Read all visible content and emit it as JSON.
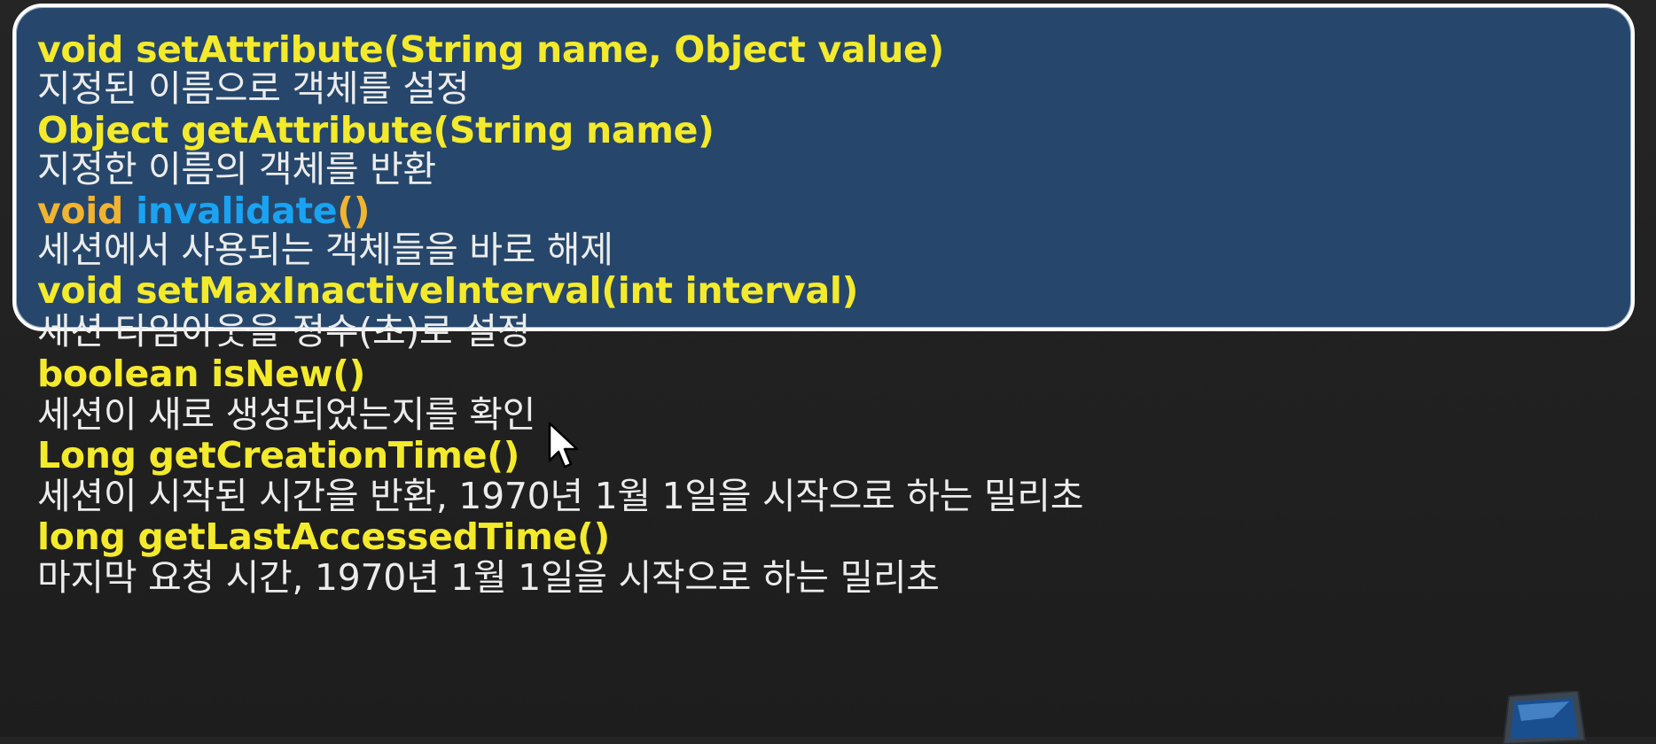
{
  "methods": [
    {
      "signature": "void setAttribute(String name, Object value)",
      "description": "지정된 이름으로 객체를 설정"
    },
    {
      "signature": "Object getAttribute(String name)",
      "description": "지정한 이름의 객체를 반환"
    },
    {
      "signature_parts": {
        "return_type": "void",
        "name": "invalidate",
        "params": "()"
      },
      "description": "세션에서 사용되는 객체들을 바로 해제"
    },
    {
      "signature": "void setMaxInactiveInterval(int interval)",
      "description": "세션 타임아웃을 정수(초)로 설정"
    },
    {
      "signature": "boolean isNew()",
      "description": "세션이 새로 생성되었는지를 확인"
    },
    {
      "signature": "Long getCreationTime()",
      "description": "세션이 시작된 시간을 반환, 1970년 1월 1일을 시작으로 하는 밀리초"
    },
    {
      "signature": "long getLastAccessedTime()",
      "description": "마지막 요청 시간, 1970년 1월 1일을 시작으로 하는 밀리초"
    }
  ],
  "colors": {
    "background": "#1f1f1f",
    "highlight_box": "#26476b",
    "signature_text": "#f4ea2c",
    "keyword_orange": "#f1b431",
    "keyword_blue": "#1aa3f2",
    "description_text": "#ececec"
  },
  "icons": [
    "mouse-cursor-icon",
    "presentation-slide-icon"
  ]
}
